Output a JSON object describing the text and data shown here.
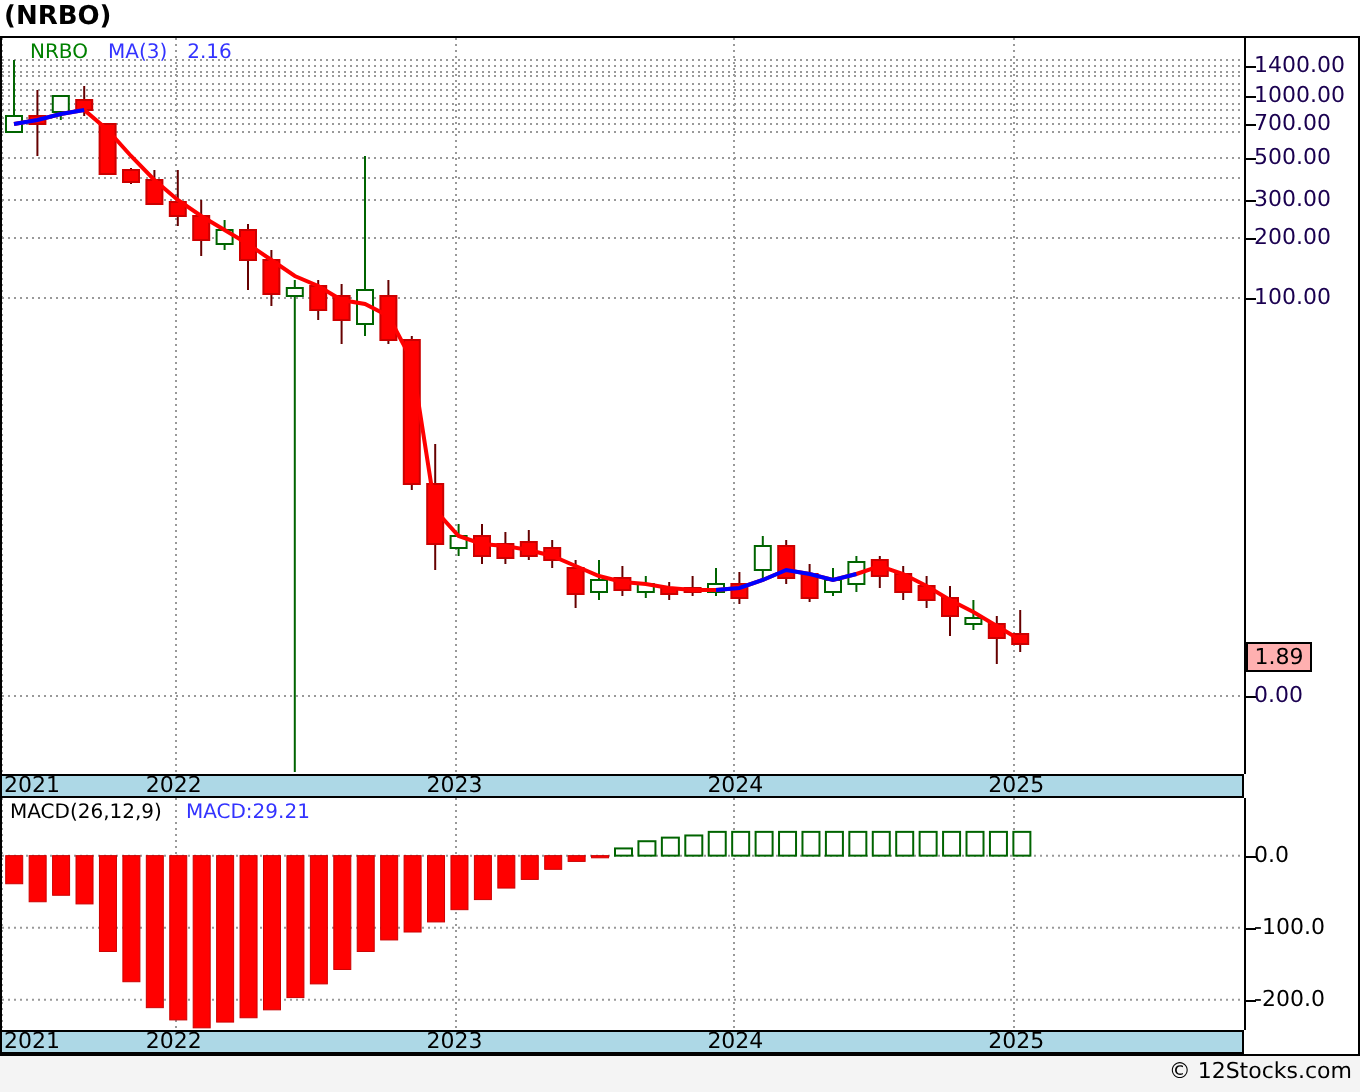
{
  "title": "(NRBO)",
  "price_panel": {
    "legend": {
      "symbol": "NRBO",
      "indicator": "MA(3)",
      "value": "2.16"
    },
    "axis_labels": [
      "1400.00",
      "1000.00",
      "700.00",
      "500.00",
      "300.00",
      "200.00",
      "100.00",
      "0.00"
    ],
    "last_price": "1.89",
    "years": [
      "2021",
      "2022",
      "2023",
      "2024",
      "2025"
    ]
  },
  "macd_panel": {
    "legend": {
      "name": "MACD(26,12,9)",
      "value": "MACD:29.21"
    },
    "years": [
      "2021",
      "2022",
      "2023",
      "2024",
      "2025"
    ],
    "chart_data": {
      "type": "bar",
      "grid": true,
      "categories": [
        null,
        null,
        null,
        null,
        null,
        null,
        null,
        null,
        null,
        null,
        null,
        null,
        null,
        null,
        null,
        null,
        null,
        null,
        null,
        null,
        null,
        null,
        null,
        null,
        null,
        null,
        null,
        null,
        null,
        null,
        null,
        null,
        null,
        null,
        null,
        null,
        null,
        null,
        null,
        null,
        null,
        null,
        null,
        null,
        null,
        null,
        null,
        null,
        null,
        null,
        null,
        null,
        null
      ],
      "ylim": [
        -242,
        80
      ],
      "yticks": [
        {
          "value": 0,
          "label": "0.0"
        },
        {
          "value": -100,
          "label": "-100.0"
        },
        {
          "value": -200,
          "label": "-200.0"
        }
      ],
      "series": [
        {
          "values": [
            -39,
            -64,
            -55,
            -67,
            -133,
            -175,
            -211,
            -228,
            -239,
            -231,
            -225,
            -214,
            -197,
            -178,
            -158,
            -133,
            -117,
            -106,
            -92,
            -75,
            -61,
            -45,
            -33,
            -19,
            -8,
            -3,
            10,
            20,
            25,
            28,
            33,
            33,
            33,
            33,
            33,
            33,
            33,
            33,
            33,
            33,
            33,
            33,
            33,
            33,
            null,
            null,
            null,
            null,
            null,
            null,
            null,
            null,
            null
          ]
        }
      ]
    }
  },
  "footer": "© 12Stocks.com"
}
